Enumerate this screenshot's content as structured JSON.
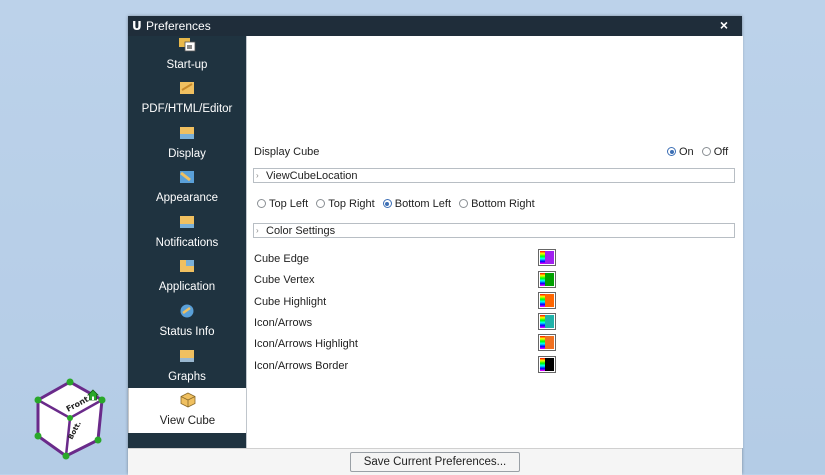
{
  "window": {
    "app_icon": "U",
    "title": "Preferences",
    "close_label": "×"
  },
  "sidebar": {
    "items": [
      {
        "label": "Start-up",
        "icon": "startup-icon"
      },
      {
        "label": "PDF/HTML/Editor",
        "icon": "pdf-editor-icon"
      },
      {
        "label": "Display",
        "icon": "display-icon"
      },
      {
        "label": "Appearance",
        "icon": "appearance-icon"
      },
      {
        "label": "Notifications",
        "icon": "notifications-icon"
      },
      {
        "label": "Application",
        "icon": "application-icon"
      },
      {
        "label": "Status Info",
        "icon": "status-info-icon"
      },
      {
        "label": "Graphs",
        "icon": "graphs-icon"
      },
      {
        "label": "View Cube",
        "icon": "view-cube-icon",
        "active": true
      }
    ]
  },
  "content": {
    "display_cube": {
      "label": "Display Cube",
      "options": [
        "On",
        "Off"
      ],
      "selected": "On"
    },
    "location_section": {
      "label": "ViewCubeLocation",
      "options": [
        "Top Left",
        "Top Right",
        "Bottom Left",
        "Bottom Right"
      ],
      "selected": "Bottom Left"
    },
    "color_section": {
      "label": "Color Settings",
      "rows": [
        {
          "label": "Cube Edge",
          "color": "#a020f0"
        },
        {
          "label": "Cube Vertex",
          "color": "#00a000"
        },
        {
          "label": "Cube Highlight",
          "color": "#ff6600"
        },
        {
          "label": "Icon/Arrows",
          "color": "#20b2aa"
        },
        {
          "label": "Icon/Arrows Highlight",
          "color": "#f07020"
        },
        {
          "label": "Icon/Arrows Border",
          "color": "#000000"
        }
      ]
    }
  },
  "footer": {
    "save_label": "Save Current Preferences..."
  },
  "cube_widget": {
    "faces": [
      "Front",
      "Bott."
    ]
  },
  "colors": {
    "titlebar": "#1f2d3a",
    "sidebar": "#1f3340",
    "radio_selected": "#3d6fb5",
    "desktop": "#b8cfe8"
  }
}
